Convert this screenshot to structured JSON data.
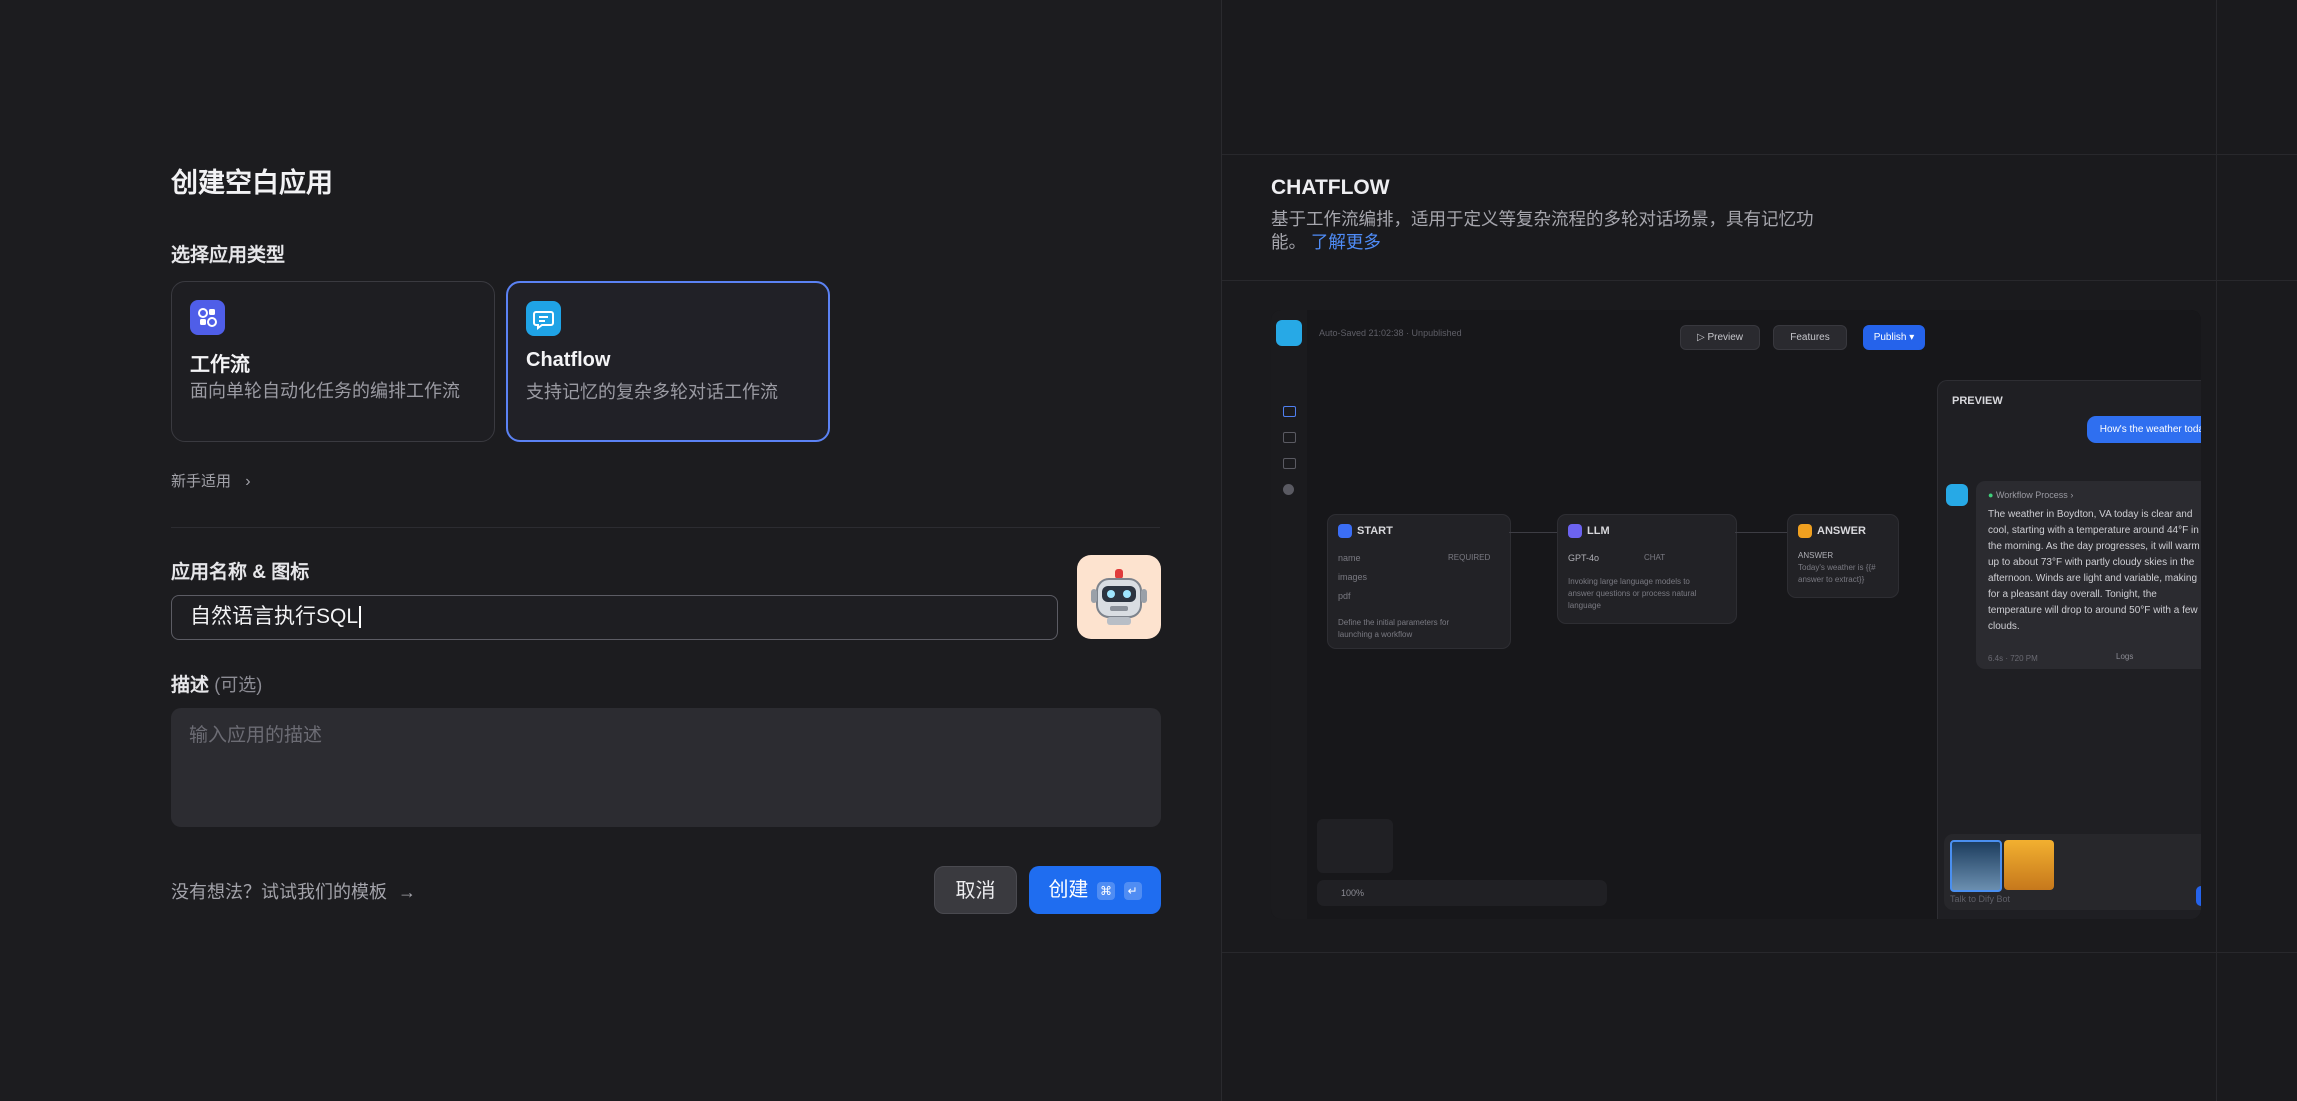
{
  "form": {
    "title": "创建空白应用",
    "type_section": "选择应用类型",
    "types": [
      {
        "name": "工作流",
        "desc": "面向单轮自动化任务的编排工作流",
        "icon": "workflow-icon",
        "color": "#4f5ee8"
      },
      {
        "name": "Chatflow",
        "desc": "支持记忆的复杂多轮对话工作流",
        "icon": "chat-icon",
        "color": "#1fa3e6"
      }
    ],
    "beginner_link": "新手适用",
    "name_section": "应用名称 & 图标",
    "name_value": "自然语言执行SQL",
    "desc_section": "描述",
    "desc_optional": "(可选)",
    "desc_placeholder": "输入应用的描述",
    "template_link": "没有想法？试试我们的模板",
    "cancel": "取消",
    "create": "创建",
    "create_keys": [
      "⌘",
      "↵"
    ]
  },
  "preview": {
    "heading": "CHATFLOW",
    "desc": "基于工作流编排，适用于定义等复杂流程的多轮对话场景，具有记忆功能。",
    "desc_line1": "基于工作流编排，适用于定义等复杂流程的多轮对话场景，具有记忆功",
    "desc_line2": "能。",
    "learn_more": "了解更多",
    "accent": "#3b82f6",
    "mock": {
      "autosave": "Auto-Saved 21:02:38 · Unpublished",
      "toolbar": [
        "Preview",
        "Features",
        "Publish"
      ],
      "nodes": {
        "start": {
          "title": "START",
          "fields": [
            "name",
            "images",
            "pdf"
          ],
          "required": "REQUIRED",
          "note1": "Define the initial parameters for",
          "note2": "launching a workflow"
        },
        "llm": {
          "title": "LLM",
          "model": "GPT-4o",
          "mode": "CHAT",
          "note1": "Invoking large language models to",
          "note2": "answer questions or process natural",
          "note3": "language"
        },
        "answer": {
          "title": "ANSWER",
          "label": "ANSWER",
          "text1": "Today's weather is {{#",
          "text2": "answer to extract}}"
        }
      },
      "panel": {
        "title": "PREVIEW",
        "user_msg": "How's the weather today",
        "process": "Workflow Process",
        "reply": "The weather in Boydton, VA today is clear and cool, starting with a temperature around 44°F in the morning. As the day progresses, it will warm up to about 73°F with partly cloudy skies in the afternoon. Winds are light and variable, making for a pleasant day overall. Tonight, the temperature will drop to around 50°F with a few clouds.",
        "meta": "6.4s · 720 PM",
        "logs": "Logs",
        "input_placeholder": "Talk to Dify Bot"
      },
      "zoom": "100%"
    }
  }
}
